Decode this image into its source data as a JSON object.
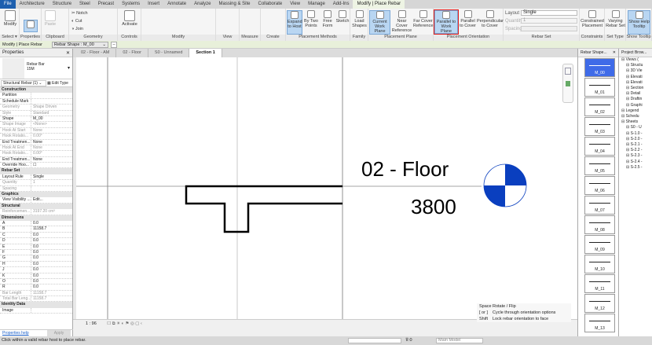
{
  "ribbon_tabs": [
    "File",
    "Architecture",
    "Structure",
    "Steel",
    "Precast",
    "Systems",
    "Insert",
    "Annotate",
    "Analyze",
    "Massing & Site",
    "Collaborate",
    "View",
    "Manage",
    "Add-Ins",
    "Modify | Place Rebar"
  ],
  "panels": {
    "select": "Select ▾",
    "properties": "Properties",
    "clipboard": "Clipboard",
    "geometry": "Geometry",
    "controls": "Controls",
    "modify": "Modify",
    "view": "View",
    "measure": "Measure",
    "create": "Create",
    "placement_methods": "Placement Methods",
    "family": "Family",
    "placement_plane": "Placement Plane",
    "placement_orientation": "Placement Orientation",
    "rebar_set": "Rebar Set",
    "constraints": "Constraints",
    "set_type": "Set Type",
    "show_tooltip": "Show Tooltip"
  },
  "buttons": {
    "modify": "Modify",
    "paste": "Paste",
    "notch": "Notch",
    "cut": "Cut",
    "join": "Join",
    "activate": "Activate",
    "expand_to_host": "Expand to Host",
    "by_two_points": "By Two Points",
    "free_form": "Free Form",
    "sketch": "Sketch",
    "load_shapes": "Load Shapes",
    "current_work_plane": "Current Work Plane",
    "near_cover": "Near Cover Reference",
    "far_cover": "Far Cover Reference",
    "parallel_work_plane": "Parallel to Work Plane",
    "parallel_cover": "Parallel to Cover",
    "perpendicular_cover": "Perpendicular to Cover",
    "constrained_placement": "Constrained Placement",
    "varying_rebar_set": "Varying Rebar Set",
    "show_help_tooltip": "Show Help Tooltip"
  },
  "rebar_set": {
    "layout_label": "Layout",
    "layout_value": "Single",
    "quantity_label": "Quantity:",
    "quantity_value": "1",
    "spacing_label": "Spacing:"
  },
  "options_bar": {
    "context": "Modify | Place Rebar",
    "rebar_shape": "Rebar Shape : M_00"
  },
  "properties": {
    "title": "Properties",
    "type_name": "Rebar Bar",
    "type_size": "15M",
    "selector": "Structural Rebar (1)",
    "edit_type": "Edit Type",
    "groups": [
      {
        "name": "Construction",
        "rows": [
          [
            "Partition",
            ""
          ],
          [
            "Schedule Mark",
            ""
          ],
          [
            "Geometry",
            "Shape Driven"
          ],
          [
            "Style",
            "Standard"
          ],
          [
            "Shape",
            "M_00"
          ],
          [
            "Shape Image",
            "<None>"
          ],
          [
            "Hook At Start",
            "None"
          ],
          [
            "Hook Rotatio...",
            "0.00°"
          ],
          [
            "End Treatmen...",
            "None"
          ],
          [
            "Hook At End",
            "None"
          ],
          [
            "Hook Rotatio...",
            "0.00°"
          ],
          [
            "End Treatmen...",
            "None"
          ],
          [
            "Override Hoo...",
            "☐"
          ]
        ]
      },
      {
        "name": "Rebar Set",
        "rows": [
          [
            "Layout Rule",
            "Single"
          ],
          [
            "Quantity",
            "1"
          ],
          [
            "Spacing",
            ""
          ]
        ]
      },
      {
        "name": "Graphics",
        "rows": [
          [
            "View Visibility ...",
            "Edit..."
          ]
        ]
      },
      {
        "name": "Structural",
        "rows": [
          [
            "Reinforcemen...",
            "3197.20 cm³"
          ]
        ]
      },
      {
        "name": "Dimensions",
        "rows": [
          [
            "A",
            "0.0"
          ],
          [
            "B",
            "11158.7"
          ],
          [
            "C",
            "0.0"
          ],
          [
            "D",
            "0.0"
          ],
          [
            "E",
            "0.0"
          ],
          [
            "F",
            "0.0"
          ],
          [
            "G",
            "0.0"
          ],
          [
            "H",
            "0.0"
          ],
          [
            "J",
            "0.0"
          ],
          [
            "K",
            "0.0"
          ],
          [
            "O",
            "0.0"
          ],
          [
            "R",
            "0.0"
          ],
          [
            "Bar Length",
            "11158.7"
          ],
          [
            "Total Bar Leng...",
            "11158.7"
          ]
        ]
      },
      {
        "name": "Identity Data",
        "rows": [
          [
            "Image",
            ""
          ]
        ]
      }
    ],
    "help_link": "Properties help",
    "apply": "Apply"
  },
  "view_tabs": [
    "02 - Floor - AM",
    "02 - Floor",
    "S0 - Unnamed",
    "Section 1"
  ],
  "canvas": {
    "level_name": "02 - Floor",
    "level_elevation": "3800",
    "scale": "1 : 96"
  },
  "tooltip": [
    [
      "Space",
      "Rotate / Flip"
    ],
    [
      "[ or ]",
      "Cycle through orientation options"
    ],
    [
      "Shift",
      "Lock rebar orientation to face"
    ]
  ],
  "rebar_shapes": {
    "title": "Rebar Shape...",
    "items": [
      "M_00",
      "M_01",
      "M_02",
      "M_03",
      "M_04",
      "M_05",
      "M_06",
      "M_07",
      "M_08",
      "M_09",
      "M_10",
      "M_11",
      "M_12",
      "M_13"
    ]
  },
  "project_browser": {
    "title": "Project Brow...",
    "items": [
      "Views (",
      "Structu",
      "3D Vie",
      "Elevati",
      "Elevati",
      "Section",
      "Detail",
      "Draftin",
      "Graphi",
      "Legend",
      "Schedu",
      "Sheets",
      "S0 - U",
      "S-1.0 -",
      "S-2.0 -",
      "S-2.1 -",
      "S-2.2 -",
      "S-2.3 -",
      "S-2.4 -",
      "S-2.5 -"
    ]
  },
  "status": {
    "message": "Click within a valid rebar host to place rebar.",
    "filter_count": ":0",
    "model": "Main Model"
  },
  "colors": {
    "accent": "#1d5fae",
    "selected_shape": "#3f6be8",
    "highlight": "#e01b1b",
    "level_symbol": "#0a3fbf"
  }
}
